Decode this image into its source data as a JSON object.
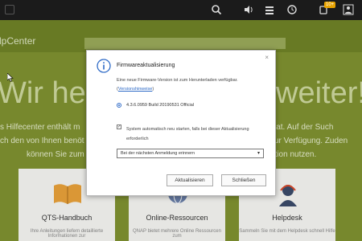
{
  "topbar": {
    "badge_count": "10+"
  },
  "background": {
    "brand": "lpCenter",
    "hero_left": "Wir helf",
    "hero_right": "weiter!",
    "p_left_lines": [
      "s Hilfecenter enthält m",
      "ch den von Ihnen benöt",
      "können Sie zum"
    ],
    "p_right_lines": [
      "Rat. Auf der Such",
      "zur Verfügung. Zuden",
      "ation nutzen."
    ],
    "cards": [
      {
        "title": "QTS-Handbuch",
        "subtitle": "Ihre Anleitungen liefern detaillierte Informationen zur"
      },
      {
        "title": "Online-Ressourcen",
        "subtitle": "QNAP bietet mehrere Online Ressourcen zum"
      },
      {
        "title": "Helpdesk",
        "subtitle": "Sammeln Sie mit dem Helpdesk schnell Hilfe"
      }
    ]
  },
  "dialog": {
    "title": "Firmwareaktualisierung",
    "message_prefix": "Eine neue Firmware-Version ist zum Herunterladen verfügbar. (",
    "release_notes_link": "Versionshinweise",
    "message_suffix": ")",
    "version_option": "4.3.6.0959 Build 20190531 Official",
    "restart_checkbox_label": "System automatisch neu starten, falls bei dieser Aktualisierung erforderlich",
    "restart_checked": true,
    "schedule_selected": "Bei der nächsten Anmeldung erinnern",
    "update_button": "Aktualisieren",
    "close_button": "Schließen",
    "close_x": "×"
  },
  "colors": {
    "accent": "#2f6bc7",
    "help_green": "#7f9130"
  }
}
